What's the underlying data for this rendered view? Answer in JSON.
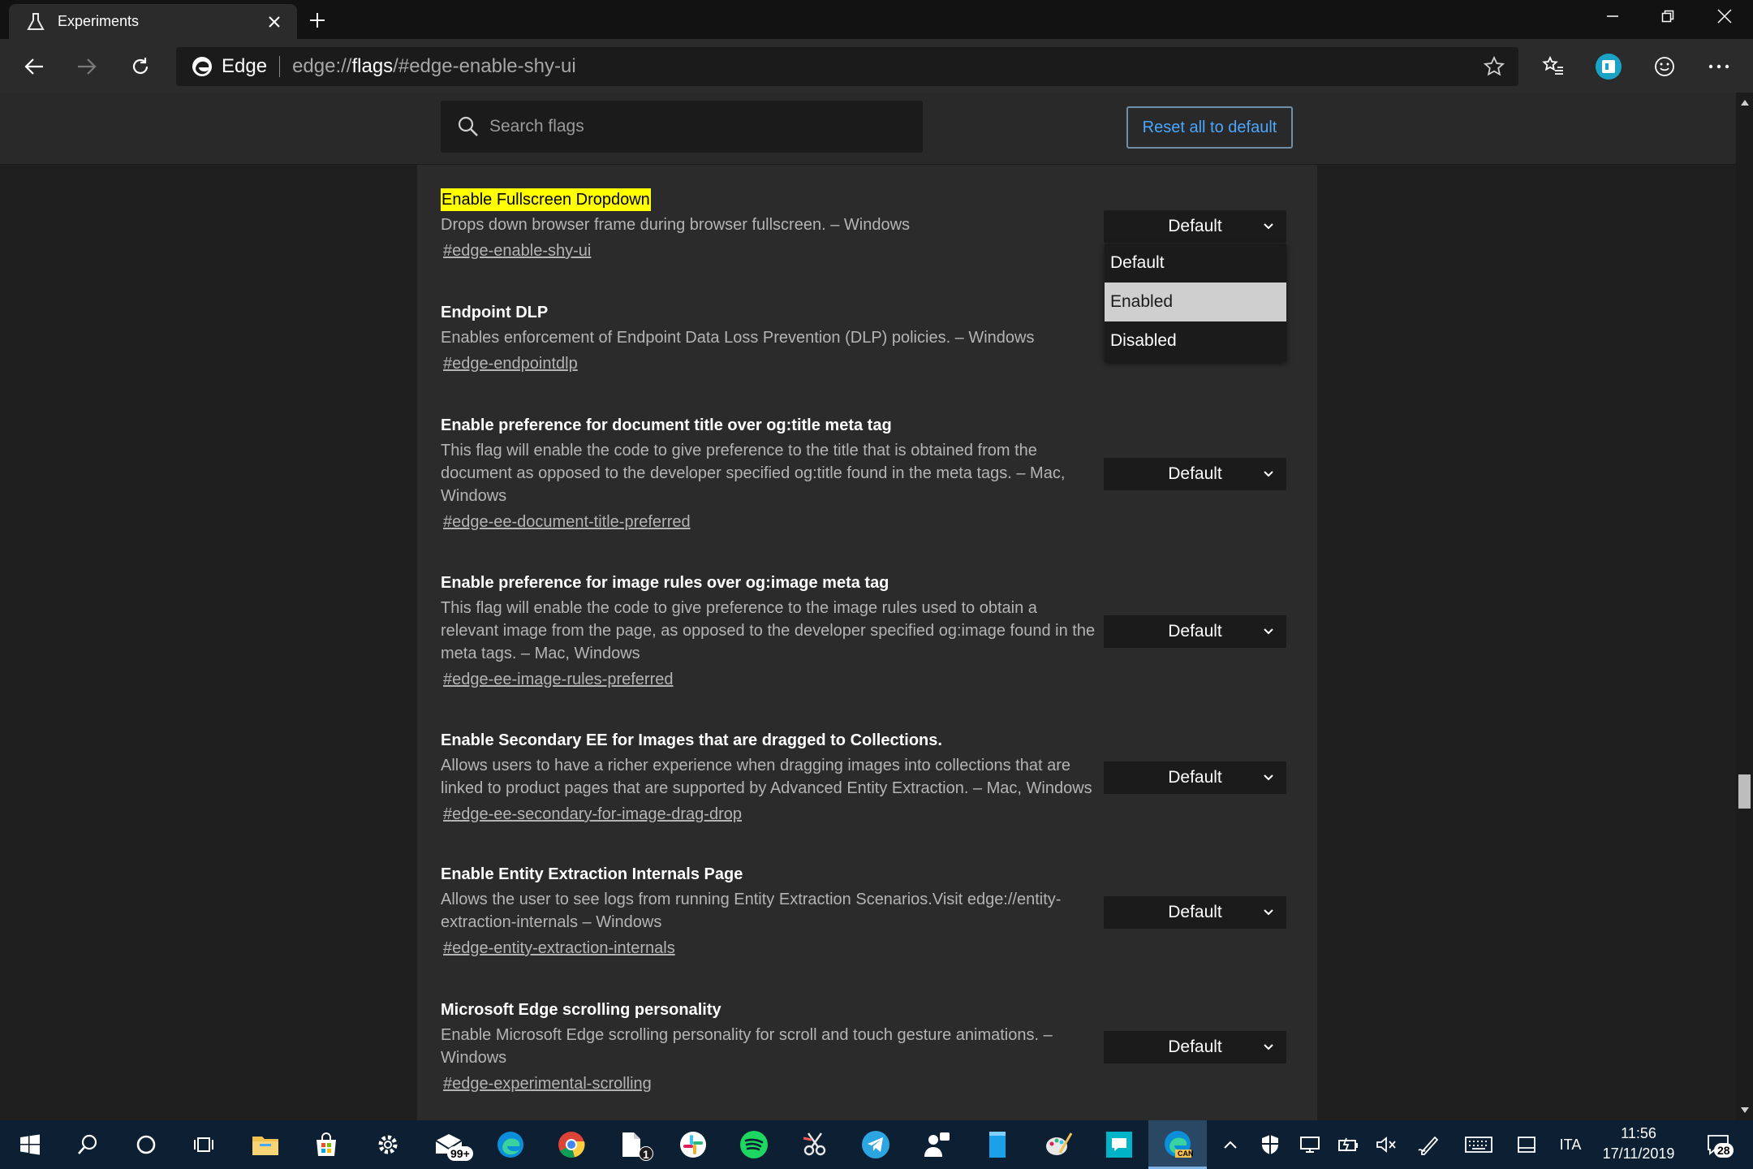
{
  "tab": {
    "title": "Experiments"
  },
  "toolbar": {
    "brand": "Edge",
    "url_scheme": "edge://",
    "url_host": "flags",
    "url_path": "/#edge-enable-shy-ui"
  },
  "header": {
    "search_placeholder": "Search flags",
    "reset_label": "Reset all to default"
  },
  "dropdown": {
    "options": [
      "Default",
      "Enabled",
      "Disabled"
    ],
    "highlighted": "Enabled"
  },
  "flags": [
    {
      "title": "Enable Fullscreen Dropdown",
      "desc": "Drops down browser frame during browser fullscreen. – Windows",
      "link": "#edge-enable-shy-ui",
      "value": "Default"
    },
    {
      "title": "Endpoint DLP",
      "desc": "Enables enforcement of Endpoint Data Loss Prevention (DLP) policies. – Windows",
      "link": "#edge-endpointdlp",
      "value": "Default"
    },
    {
      "title": "Enable preference for document title over og:title meta tag",
      "desc": "This flag will enable the code to give preference to the title that is obtained from the document as opposed to the developer specified og:title found in the meta tags. – Mac, Windows",
      "link": "#edge-ee-document-title-preferred",
      "value": "Default"
    },
    {
      "title": "Enable preference for image rules over og:image meta tag",
      "desc": "This flag will enable the code to give preference to the image rules used to obtain a relevant image from the page, as opposed to the developer specified og:image found in the meta tags. – Mac, Windows",
      "link": "#edge-ee-image-rules-preferred",
      "value": "Default"
    },
    {
      "title": "Enable Secondary EE for Images that are dragged to Collections.",
      "desc": "Allows users to have a richer experience when dragging images into collections that are linked to product pages that are supported by Advanced Entity Extraction. – Mac, Windows",
      "link": "#edge-ee-secondary-for-image-drag-drop",
      "value": "Default"
    },
    {
      "title": "Enable Entity Extraction Internals Page",
      "desc": "Allows the user to see logs from running Entity Extraction Scenarios.Visit edge://entity-extraction-internals – Windows",
      "link": "#edge-entity-extraction-internals",
      "value": "Default"
    },
    {
      "title": "Microsoft Edge scrolling personality",
      "desc": "Enable Microsoft Edge scrolling personality for scroll and touch gesture animations. – Windows",
      "link": "#edge-experimental-scrolling",
      "value": "Default"
    }
  ],
  "taskbar": {
    "mail_badge": "99+",
    "files_badge": "1",
    "edge_canary_label": "CAN",
    "language": "ITA",
    "time": "11:56",
    "date": "17/11/2019",
    "notifications": "28"
  },
  "colors": {
    "highlight": "#ffff00",
    "link_blue": "#4aa6ff",
    "taskbar": "#0d1f33"
  }
}
